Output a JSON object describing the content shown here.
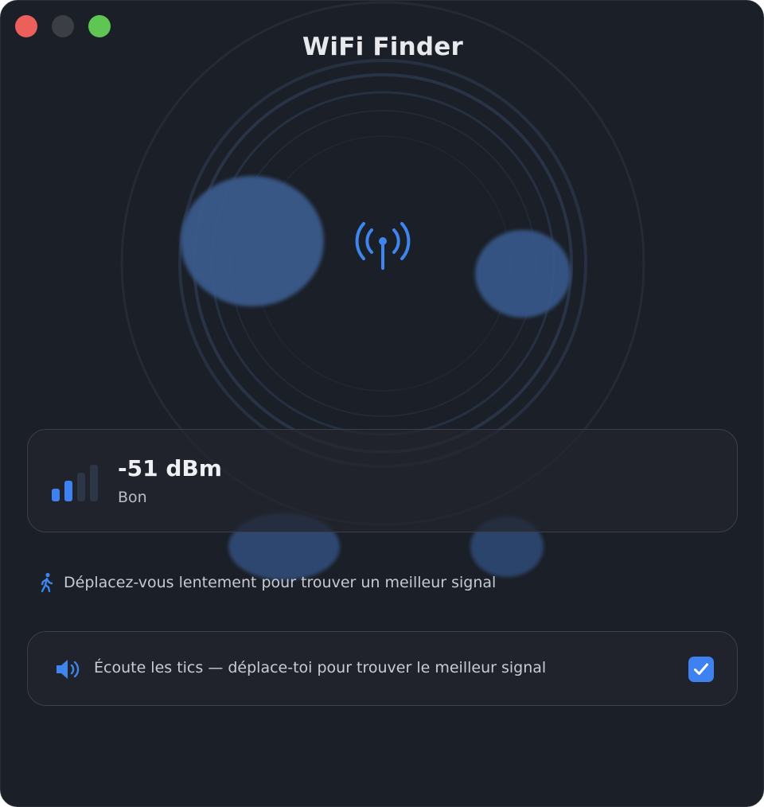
{
  "window": {
    "title": "WiFi Finder"
  },
  "signal": {
    "dbm_text": "-51 dBm",
    "quality": "Bon",
    "bars_total": 4,
    "bars_active": 2
  },
  "hint": {
    "icon": "walking-person-icon",
    "text": "Déplacez-vous lentement pour trouver un meilleur signal"
  },
  "sound": {
    "icon": "speaker-wave-icon",
    "label": "Écoute les tics — déplace-toi pour trouver le meilleur signal",
    "enabled": true
  },
  "colors": {
    "accent": "#3d82f0",
    "background": "#1b1f27",
    "bar_inactive": "#2d3646"
  }
}
